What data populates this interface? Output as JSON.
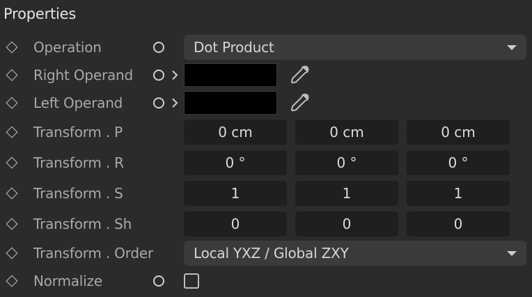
{
  "panel": {
    "title": "Properties"
  },
  "rows": {
    "operation": {
      "label": "Operation",
      "value": "Dot Product"
    },
    "right_operand": {
      "label": "Right Operand",
      "color": "#000000"
    },
    "left_operand": {
      "label": "Left Operand",
      "color": "#000000"
    },
    "transform_p": {
      "label": "Transform . P",
      "values": [
        "0 cm",
        "0 cm",
        "0 cm"
      ]
    },
    "transform_r": {
      "label": "Transform . R",
      "values": [
        "0 °",
        "0 °",
        "0 °"
      ]
    },
    "transform_s": {
      "label": "Transform . S",
      "values": [
        "1",
        "1",
        "1"
      ]
    },
    "transform_sh": {
      "label": "Transform . Sh",
      "values": [
        "0",
        "0",
        "0"
      ]
    },
    "transform_order": {
      "label": "Transform . Order",
      "value": "Local YXZ / Global ZXY"
    },
    "normalize": {
      "label": "Normalize",
      "checked": false
    }
  },
  "icons": {
    "keyframe": "diamond-icon",
    "port": "circle-icon",
    "expand": "chevron-right-icon",
    "picker": "eyedropper-icon",
    "dropdown": "chevron-down-icon"
  }
}
